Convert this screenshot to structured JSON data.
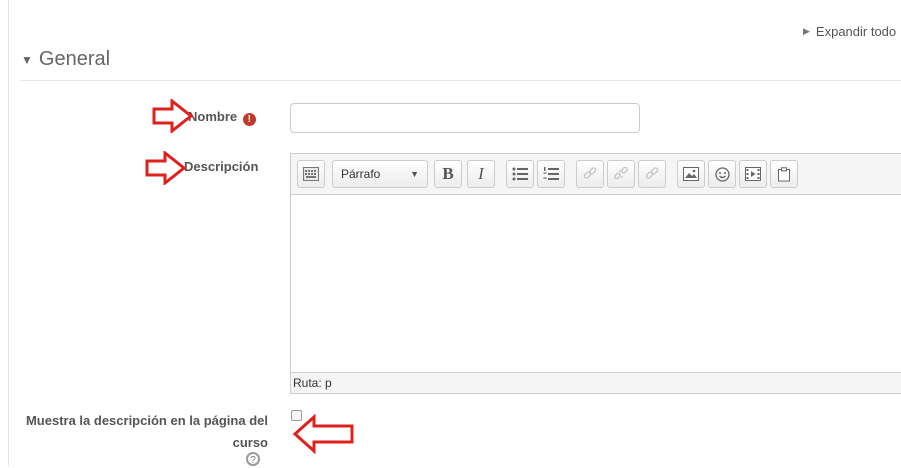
{
  "header": {
    "expand_all_label": "Expandir todo"
  },
  "section": {
    "title": "General"
  },
  "form": {
    "name_label": "Nombre",
    "name_value": "",
    "description_label": "Descripción",
    "show_description_label": "Muestra la descripción en la página del curso",
    "show_description_checked": false
  },
  "editor": {
    "format_value": "Párrafo",
    "bold_label": "B",
    "italic_label": "I",
    "status_path": "Ruta: p",
    "body_text": ""
  },
  "icons": {
    "required": "exclamation-circle-icon",
    "help": "question-circle-icon",
    "annotation": "red-arrow-icon"
  },
  "colors": {
    "required": "#c0392b",
    "annotation_arrow": "#e0201c"
  }
}
